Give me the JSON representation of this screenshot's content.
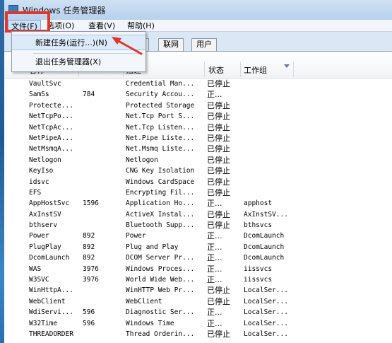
{
  "window": {
    "title": "Windows 任务管理器"
  },
  "menubar": {
    "items": [
      "文件(F)",
      "选项(O)",
      "查看(V)",
      "帮助(H)"
    ]
  },
  "file_menu": {
    "items": [
      "新建任务(运行...)(N)",
      "退出任务管理器(X)"
    ]
  },
  "tabs": [
    "能",
    "联网",
    "用户"
  ],
  "columns": {
    "name": "名称",
    "pid": "PID",
    "description": "描述",
    "status": "状态",
    "group": "工作组"
  },
  "services": [
    {
      "name": "VaultSvc",
      "pid": "",
      "desc": "Credential Man...",
      "status": "已停止",
      "group": ""
    },
    {
      "name": "SamSs",
      "pid": "784",
      "desc": "Security Accou...",
      "status": "正...",
      "group": ""
    },
    {
      "name": "Protecte...",
      "pid": "",
      "desc": "Protected Storage",
      "status": "已停止",
      "group": ""
    },
    {
      "name": "NetTcpPo...",
      "pid": "",
      "desc": "Net.Tcp Port S...",
      "status": "已停止",
      "group": ""
    },
    {
      "name": "NetTcpAc...",
      "pid": "",
      "desc": "Net.Tcp Listen...",
      "status": "已停止",
      "group": ""
    },
    {
      "name": "NetPipeA...",
      "pid": "",
      "desc": "Net.Pipe Liste...",
      "status": "已停止",
      "group": ""
    },
    {
      "name": "NetMsmqA...",
      "pid": "",
      "desc": "Net.Msmq Liste...",
      "status": "已停止",
      "group": ""
    },
    {
      "name": "Netlogon",
      "pid": "",
      "desc": "Netlogon",
      "status": "已停止",
      "group": ""
    },
    {
      "name": "KeyIso",
      "pid": "",
      "desc": "CNG Key Isolation",
      "status": "已停止",
      "group": ""
    },
    {
      "name": "idsvc",
      "pid": "",
      "desc": "Windows CardSpace",
      "status": "已停止",
      "group": ""
    },
    {
      "name": "EFS",
      "pid": "",
      "desc": "Encrypting Fil...",
      "status": "已停止",
      "group": ""
    },
    {
      "name": "AppHostSvc",
      "pid": "1596",
      "desc": "Application Ho...",
      "status": "正...",
      "group": "apphost"
    },
    {
      "name": "AxInstSV",
      "pid": "",
      "desc": "ActiveX Instal...",
      "status": "已停止",
      "group": "AxInstSV..."
    },
    {
      "name": "bthserv",
      "pid": "",
      "desc": "Bluetooth Supp...",
      "status": "已停止",
      "group": "bthsvcs"
    },
    {
      "name": "Power",
      "pid": "892",
      "desc": "Power",
      "status": "正...",
      "group": "DcomLaunch"
    },
    {
      "name": "PlugPlay",
      "pid": "892",
      "desc": "Plug and Play",
      "status": "正...",
      "group": "DcomLaunch"
    },
    {
      "name": "DcomLaunch",
      "pid": "892",
      "desc": "DCOM Server Pr...",
      "status": "正...",
      "group": "DcomLaunch"
    },
    {
      "name": "WAS",
      "pid": "3976",
      "desc": "Windows Proces...",
      "status": "正...",
      "group": "iissvcs"
    },
    {
      "name": "W3SVC",
      "pid": "3976",
      "desc": "World Wide Web...",
      "status": "正...",
      "group": "iissvcs"
    },
    {
      "name": "WinHttpA...",
      "pid": "",
      "desc": "WinHTTP Web Pr...",
      "status": "已停止",
      "group": "LocalSer..."
    },
    {
      "name": "WebClient",
      "pid": "",
      "desc": "WebClient",
      "status": "已停止",
      "group": "LocalSer..."
    },
    {
      "name": "WdiServi...",
      "pid": "596",
      "desc": "Diagnostic Ser...",
      "status": "正...",
      "group": "LocalSer..."
    },
    {
      "name": "W32Time",
      "pid": "596",
      "desc": "Windows Time",
      "status": "正...",
      "group": "LocalSer..."
    },
    {
      "name": "THREADORDER",
      "pid": "",
      "desc": "Thread Orderin...",
      "status": "已停止",
      "group": "LocalSer..."
    }
  ],
  "colors": {
    "highlight_border": "#e0362c",
    "annotation_arrow": "#e0362c",
    "menu_hover": "#dceafa"
  }
}
